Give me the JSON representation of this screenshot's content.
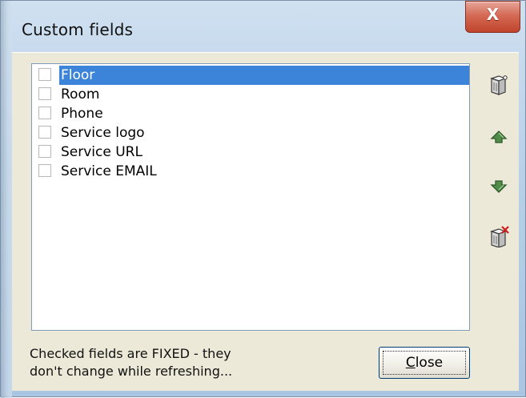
{
  "window": {
    "title": "Custom fields",
    "close_glyph": "X"
  },
  "list": {
    "items": [
      {
        "label": "Floor",
        "checked": false,
        "selected": true
      },
      {
        "label": "Room",
        "checked": false,
        "selected": false
      },
      {
        "label": "Phone",
        "checked": false,
        "selected": false
      },
      {
        "label": "Service logo",
        "checked": false,
        "selected": false
      },
      {
        "label": "Service URL",
        "checked": false,
        "selected": false
      },
      {
        "label": "Service EMAIL",
        "checked": false,
        "selected": false
      }
    ]
  },
  "side_toolbar": {
    "icons": [
      "new-field-icon",
      "move-up-icon",
      "move-down-icon",
      "delete-field-icon"
    ]
  },
  "footer": {
    "status_line1": "Checked fields are FIXED - they",
    "status_line2": "don't change while refreshing...",
    "close_label": "Close"
  },
  "colors": {
    "selection": "#3b84d9",
    "close_red": "#c0442c",
    "arrow_green": "#3f7a3a"
  }
}
